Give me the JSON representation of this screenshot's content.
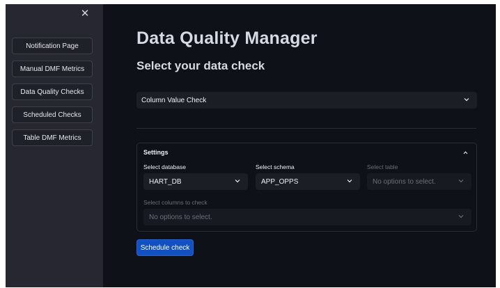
{
  "sidebar": {
    "close_icon": "close-icon",
    "items": [
      {
        "label": "Notification Page"
      },
      {
        "label": "Manual DMF Metrics"
      },
      {
        "label": "Data Quality Checks"
      },
      {
        "label": "Scheduled Checks"
      },
      {
        "label": "Table DMF Metrics"
      }
    ]
  },
  "main": {
    "title": "Data Quality Manager",
    "subtitle": "Select your data check",
    "check_select": {
      "value": "Column Value Check",
      "icon": "chevron-down-icon"
    },
    "settings": {
      "title": "Settings",
      "icon": "chevron-up-icon",
      "database": {
        "label": "Select database",
        "value": "HART_DB"
      },
      "schema": {
        "label": "Select schema",
        "value": "APP_OPPS"
      },
      "table": {
        "label": "Select table",
        "placeholder": "No options to select."
      },
      "columns": {
        "label": "Select columns to check",
        "placeholder": "No options to select."
      }
    },
    "schedule_button": "Schedule check"
  },
  "colors": {
    "background": "#0e1117",
    "sidebar": "#262730",
    "primary": "#1251c4"
  }
}
